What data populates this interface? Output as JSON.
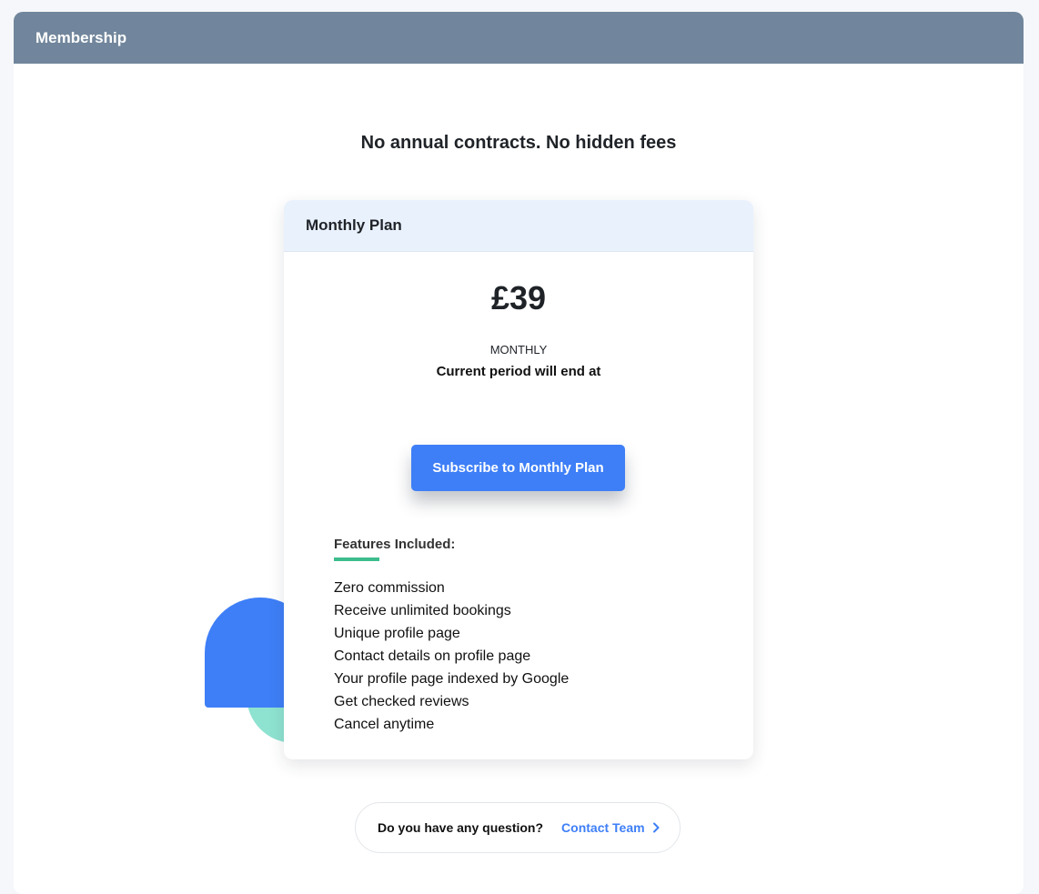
{
  "header": {
    "title": "Membership"
  },
  "tagline": "No annual contracts. No hidden fees",
  "plan": {
    "name": "Monthly Plan",
    "price": "£39",
    "period": "MONTHLY",
    "period_end_text": "Current period will end at",
    "subscribe_label": "Subscribe to Monthly Plan",
    "features_title": "Features Included:",
    "features": [
      "Zero commission",
      "Receive unlimited bookings",
      "Unique profile page",
      "Contact details on profile page",
      "Your profile page indexed by Google",
      "Get checked reviews",
      "Cancel anytime"
    ]
  },
  "contact": {
    "question": "Do you have any question?",
    "link_label": "Contact Team",
    "link_icon": "chevron-right-icon"
  },
  "colors": {
    "header_bg": "#71869c",
    "accent_blue": "#3e7ff7",
    "accent_green": "#3dbd8e",
    "deco_teal": "#8ee2d0",
    "plan_header_bg": "#e9f1fd"
  }
}
